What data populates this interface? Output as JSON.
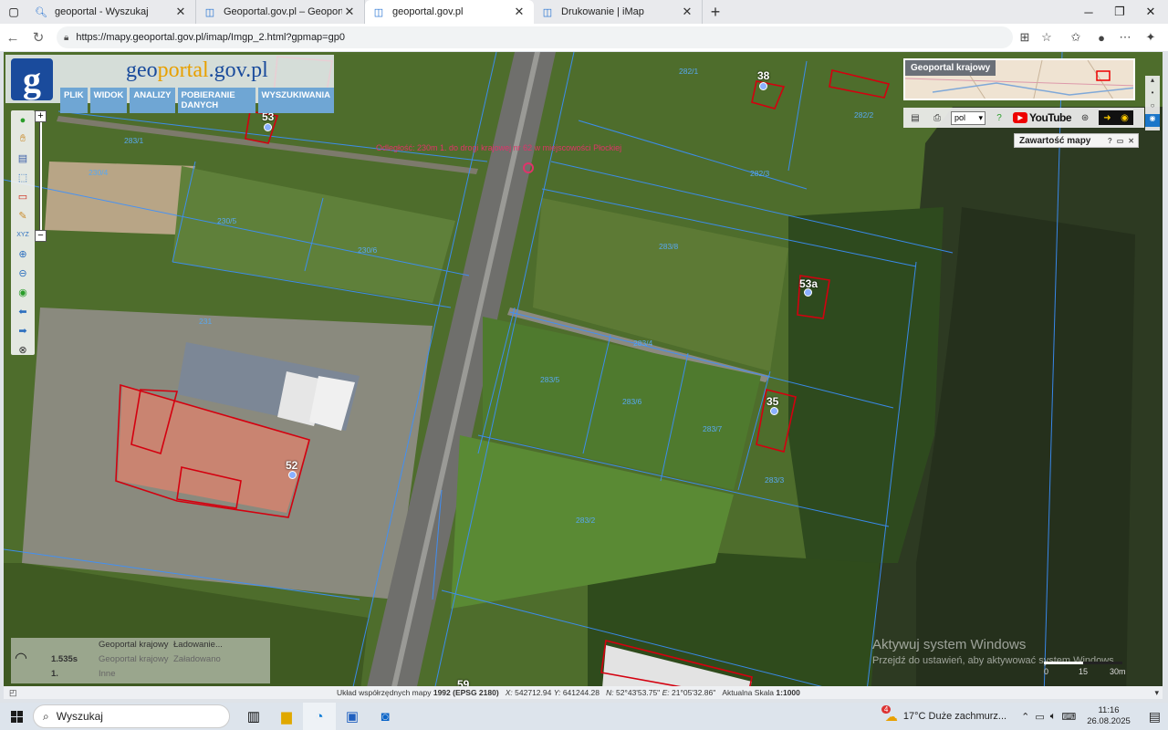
{
  "browser": {
    "tabs": [
      {
        "title": "geoportal - Wyszukaj",
        "icon": "search-favicon",
        "active": false
      },
      {
        "title": "Geoportal.gov.pl – Geoportal Infr...",
        "icon": "page-favicon",
        "active": false
      },
      {
        "title": "geoportal.gov.pl",
        "icon": "page-favicon",
        "active": true
      },
      {
        "title": "Drukowanie | iMap",
        "icon": "page-favicon",
        "active": false
      }
    ],
    "url": "https://mapy.geoportal.gov.pl/imap/Imgp_2.html?gpmap=gp0"
  },
  "geoportal": {
    "logo_letter": "g",
    "logo_text_pre": "geo",
    "logo_text_accent": "portal",
    "logo_text_post": ".gov.pl",
    "menu": [
      "PLIK",
      "WIDOK",
      "ANALIZY",
      "POBIERANIE DANYCH",
      "WYSZUKIWANIA"
    ],
    "overview_title": "Geoportal krajowy",
    "lang_value": "pol",
    "youtube_label": "YouTube",
    "content_window_title": "Zawartość mapy",
    "zoom_plus": "+",
    "zoom_minus": "−"
  },
  "map": {
    "road_label": "Odległość: 230m 1. do drogi krajowej nr 62 w miejscowości Płockiej",
    "parcels": [
      "282/1",
      "282/2",
      "282/3",
      "283/1",
      "230/4",
      "230/5",
      "230/6",
      "283/8",
      "231",
      "283/4",
      "283/5",
      "283/6",
      "283/7",
      "283/3",
      "283/2"
    ],
    "house_numbers": [
      "38",
      "53",
      "53a",
      "35",
      "52",
      "59"
    ]
  },
  "loading": {
    "rows": [
      {
        "time": "",
        "source": "Geoportal krajowy",
        "status": "Ładowanie..."
      },
      {
        "time": "1.535s",
        "source": "Geoportal krajowy",
        "status": "Załadowano"
      },
      {
        "time": "1.",
        "source": "Inne",
        "status": ""
      }
    ]
  },
  "watermark": {
    "line1": "Aktywuj system Windows",
    "line2": "Przejdź do ustawień, aby aktywować system Windows."
  },
  "scale": {
    "labels": [
      "0",
      "15",
      "30m"
    ]
  },
  "statusbar": {
    "prefix": "Układ współrzędnych mapy",
    "system": "1992 (EPSG 2180)",
    "x_label": "X:",
    "x_value": "542712.94",
    "y_label": "Y:",
    "y_value": "641244.28",
    "n_label": "N:",
    "n_value": "52°43'53.75\"",
    "e_label": "E:",
    "e_value": "21°05'32.86\"",
    "scale_label": "Aktualna Skala",
    "scale_value": "1:1000"
  },
  "taskbar": {
    "search_placeholder": "Wyszukaj",
    "weather": "17°C  Duże zachmurz...",
    "weather_badge": "4",
    "time": "11:16",
    "date": "26.08.2025"
  }
}
